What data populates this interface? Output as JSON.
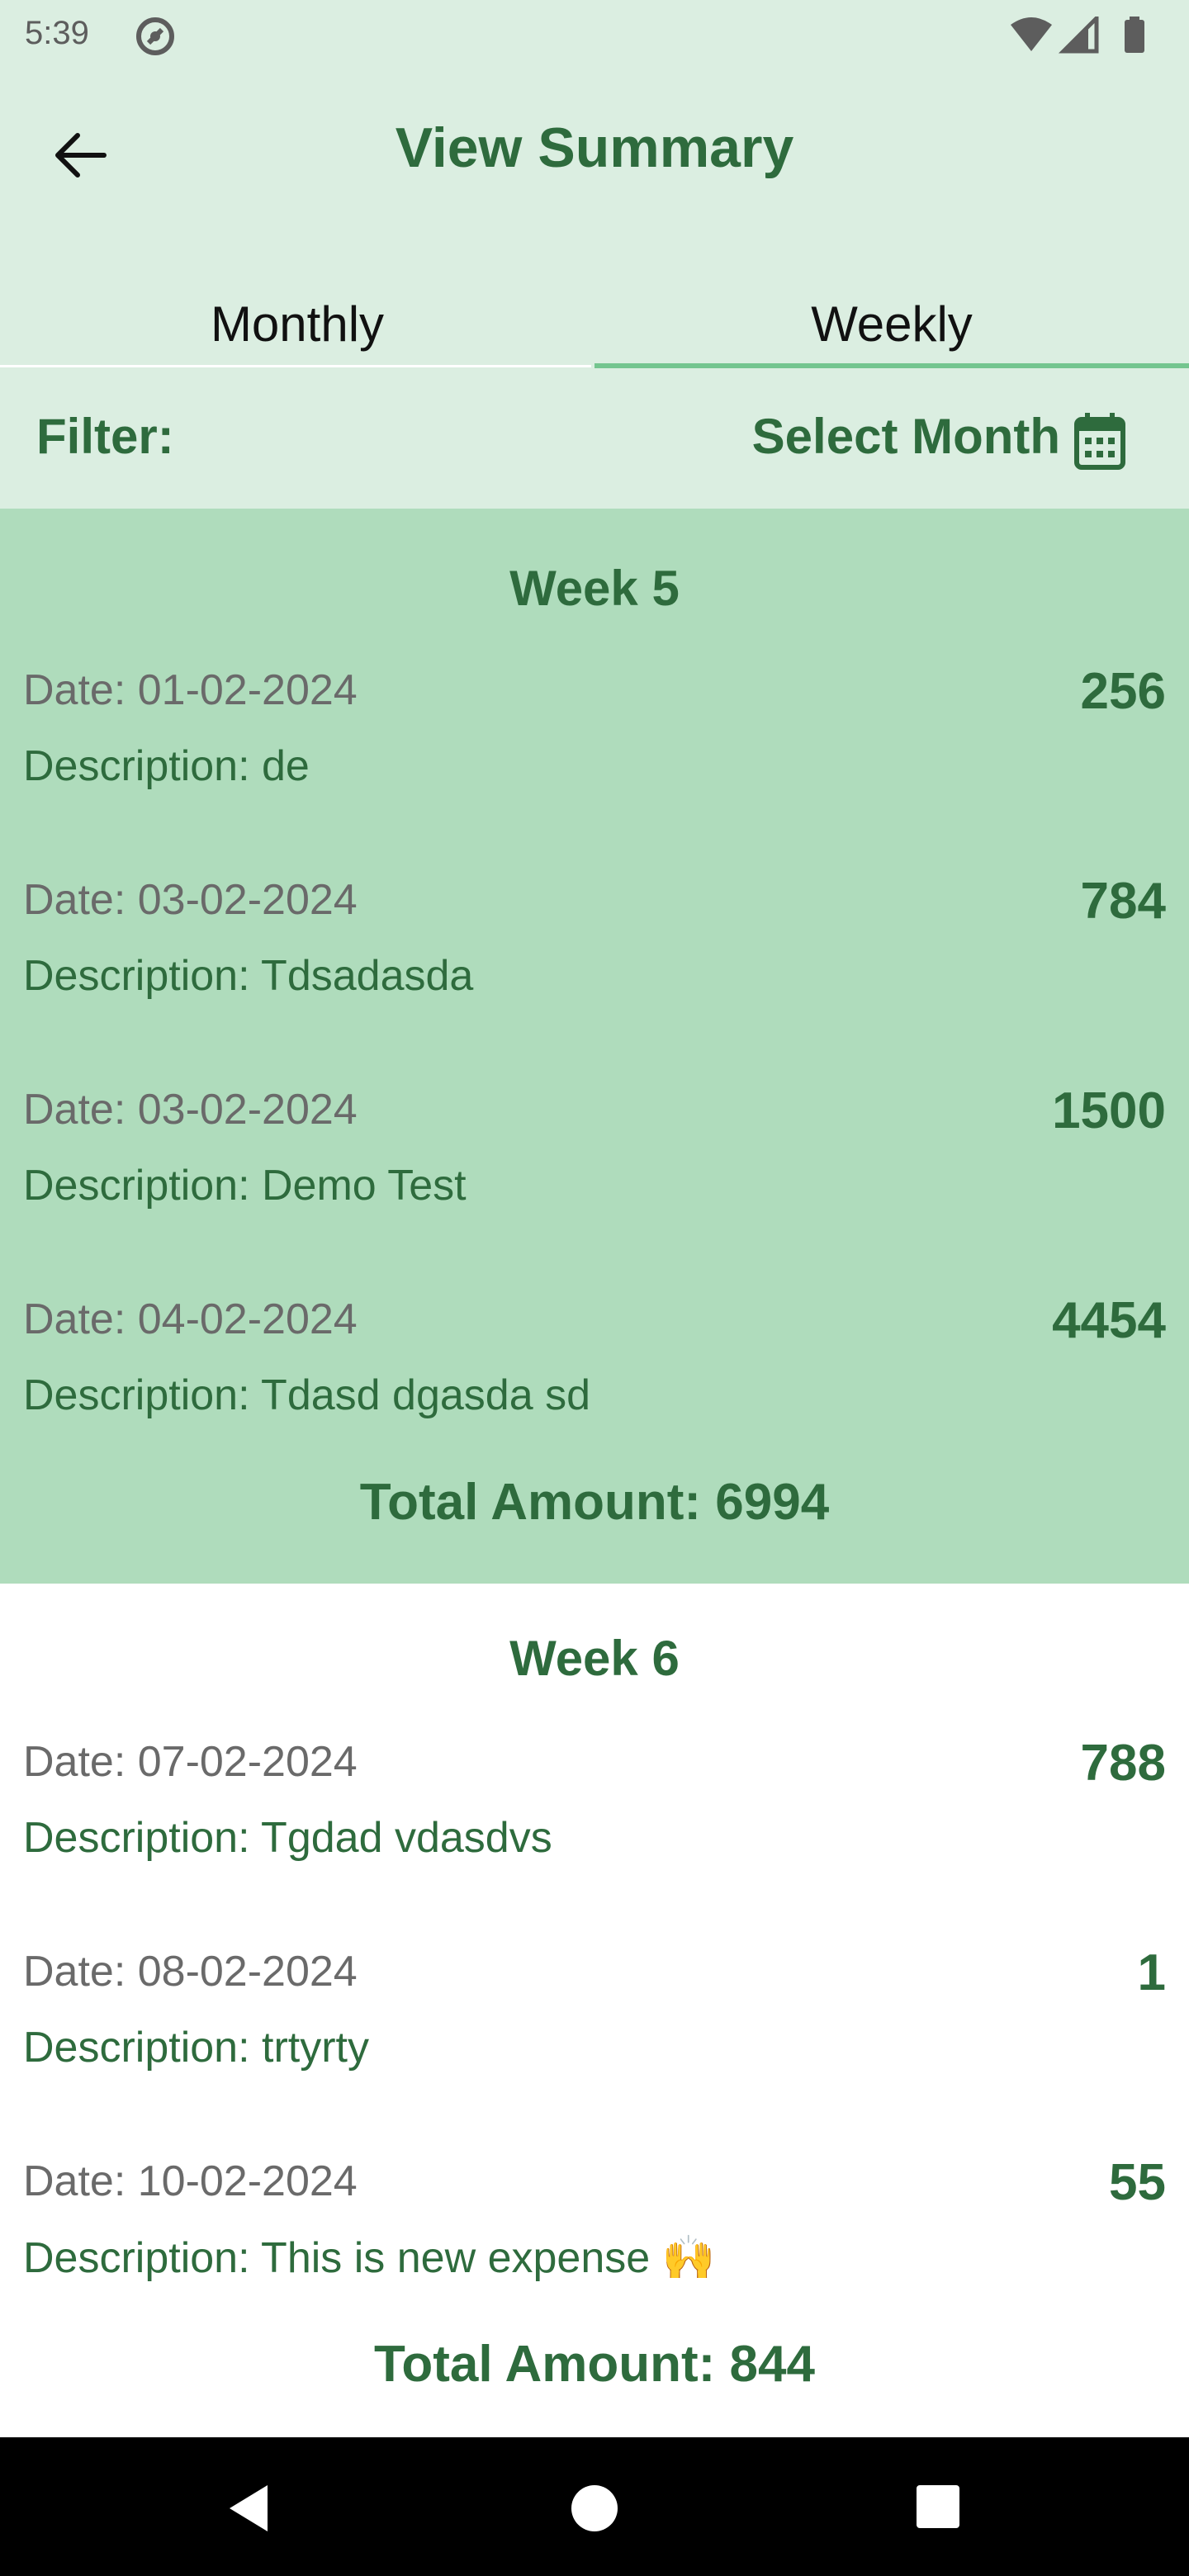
{
  "status_bar": {
    "time": "5:39"
  },
  "header": {
    "title": "View Summary"
  },
  "tabs": [
    {
      "label": "Monthly",
      "selected": false
    },
    {
      "label": "Weekly",
      "selected": true
    }
  ],
  "filter": {
    "label": "Filter:",
    "select_label": "Select Month"
  },
  "weeks": [
    {
      "title": "Week 5",
      "entries": [
        {
          "date": "Date: 01-02-2024",
          "amount": "256",
          "description": "Description: de"
        },
        {
          "date": "Date: 03-02-2024",
          "amount": "784",
          "description": "Description: Tdsadasda"
        },
        {
          "date": "Date: 03-02-2024",
          "amount": "1500",
          "description": "Description: Demo Test"
        },
        {
          "date": "Date: 04-02-2024",
          "amount": "4454",
          "description": "Description: Tdasd dgasda sd"
        }
      ],
      "total": "Total Amount: 6994"
    },
    {
      "title": "Week 6",
      "entries": [
        {
          "date": "Date: 07-02-2024",
          "amount": "788",
          "description": "Description: Tgdad vdasdvs"
        },
        {
          "date": "Date: 08-02-2024",
          "amount": "1",
          "description": "Description: trtyrty"
        },
        {
          "date": "Date: 10-02-2024",
          "amount": "55",
          "description": "Description: This is new expense 🙌"
        }
      ],
      "total": "Total Amount: 844"
    }
  ],
  "colors": {
    "primary": "#2e6b3d",
    "header_bg": "#dbeee1",
    "highlight_card": "#afdcbc",
    "tab_indicator": "#74c58f"
  }
}
